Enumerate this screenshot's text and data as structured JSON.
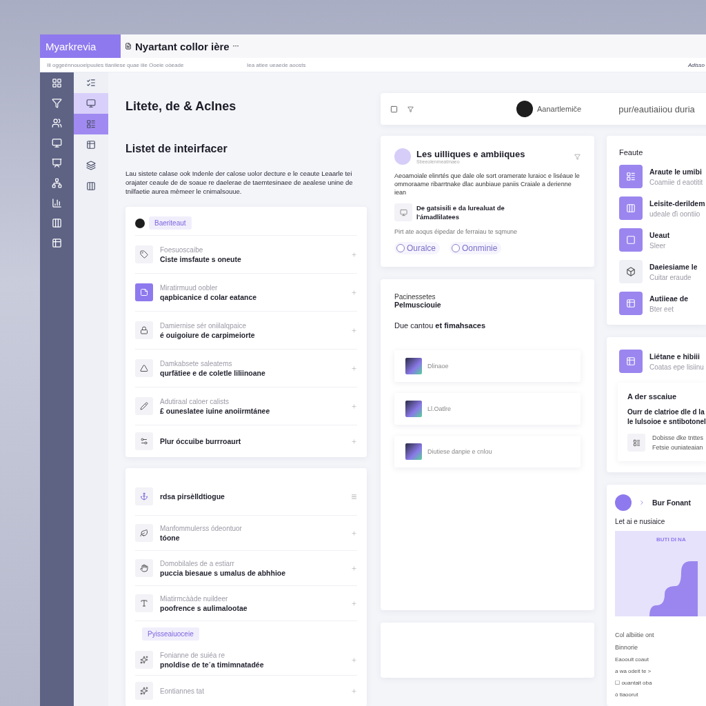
{
  "topbar": {
    "brand": "Myarkrevia",
    "title": "Nyartant collor ière",
    "more": "···"
  },
  "subbar": {
    "left": "Ill oggeénnouoeipuules tlaniiese quae iiie Ooeie oòeade",
    "middle": "Iea atiee ueaede aoosts",
    "right": "Adisso"
  },
  "subnav": [
    {
      "selected": false,
      "highlighted": false
    },
    {
      "selected": false,
      "highlighted": true
    },
    {
      "selected": true,
      "highlighted": false
    },
    {
      "selected": false,
      "highlighted": false
    },
    {
      "selected": false,
      "highlighted": false
    },
    {
      "selected": false,
      "highlighted": false
    }
  ],
  "main": {
    "title": "Litete, de & Aclnes",
    "section_title": "Listet de inteirfacer",
    "intro": "Lau sistete calase ook Indenle der calose uolor decture e le ceaute Leaarle tei orajater ceaule de de soaue re daelerae de taemtesinaee de aealese unine de tnilfaetie aurea mèmeer le cnimalsouue.",
    "list": {
      "chip": "Baeriteaut",
      "items": [
        {
          "label": "Foesuoscaibe",
          "title": "Ciste imsfaute s oneute",
          "accent": false
        },
        {
          "label": "Miratirmuud oobler",
          "title": "qapbicanice d colar eatance",
          "accent": true
        },
        {
          "label": "Damiernise sér oniilalqpaice",
          "title": "é ouigoiure de carpimeiorte",
          "accent": false
        },
        {
          "label": "Damkabsete saleatems",
          "title": "qurfätiee e de coletle liliinoane",
          "accent": false
        },
        {
          "label": "Adutiraal caloer calists",
          "title": "£ ouneslatee iuine anoiirmtánee",
          "accent": false
        }
      ],
      "footer": "Plur óccuibe burrroaurt"
    },
    "list2": {
      "header": "rdsa pirsèlldtiogue",
      "items": [
        {
          "label": "Manfommulerss ódeontuor",
          "title": "tóone"
        },
        {
          "label": "Domobilales de a estiarr",
          "title": "puccia biesaue s umalus de abhhioe"
        },
        {
          "label": "Miatirmcààde nuildeer",
          "title": "poofrence s aulimalootae"
        }
      ],
      "chip": "Pyisseaiuoceie",
      "items2": [
        {
          "label": "Fonianne de suiéa re",
          "title": "pnoldise de te´a timimnatadée"
        },
        {
          "label": "Eontiannes tat"
        }
      ]
    }
  },
  "header_bar": {
    "name": "Aanartlemiče",
    "headline": "pur/eautiaiiou duria"
  },
  "card_a": {
    "title": "Les uilliques e ambiiques",
    "subtitle": "Sbeeolenmeatmaeo",
    "body": "Aeoamoiale elinrtés que dale ole sort oramerate luraioc e liséaue le ommoraame ribarrtnake dlac aunbiaue paniis Craiale a derienne iean",
    "feature": "De gatsisili e da lurealuat de l'ámadlilatees",
    "note": "Pirt ate aoqus éipedar de ferraiau te sqmune",
    "options": [
      {
        "label": "Ouralce",
        "selected": false
      },
      {
        "label": "Oonminie",
        "selected": false
      }
    ]
  },
  "card_b": {
    "kicker": "Pacinessetes",
    "title": "Pelmusciouie",
    "line": "Due cantou **et fimahsaces**",
    "items": [
      "Dlinaoe",
      "Ll.Oatlre",
      "Diutiese danpie e cnlou"
    ]
  },
  "features": {
    "title": "Feaute",
    "items": [
      {
        "title": "Araute le umibi",
        "subtitle": "Coamiie d eaotitit",
        "accent": true
      },
      {
        "title": "Leisite-derildem",
        "subtitle": "udeale ďi oontiio",
        "accent": true
      },
      {
        "title": "Ueaut",
        "subtitle": "Sleer",
        "accent": true
      },
      {
        "title": "Daeiesiame le",
        "subtitle": "Cuitar eraude",
        "accent": false
      },
      {
        "title": "Autiieae de",
        "subtitle": "Bter eet",
        "accent": true
      }
    ]
  },
  "panel": {
    "item_title": "Liétane e hibiii",
    "item_subtitle": "Coatas epe lisiinu",
    "inner_title": "A der sscaiue",
    "inner_text": "Ourr de clatrioe dle d la le lulsoioe e sntibotonel",
    "row_title": "Dobisse dke tnttes",
    "row_subtitle": "Fetsie ouniateaian"
  },
  "chart_card": {
    "title": "Bur Fonant",
    "chart_label": "Let ai e nusiaice",
    "chart_tag": "BUTI DI NA",
    "caption": "Col albiitie ont",
    "sub": "Binnorie",
    "lines": [
      "Eaooult coaut",
      "a wa odeit te >",
      "☐ ouantait oba",
      "ó tiaoorut"
    ]
  }
}
